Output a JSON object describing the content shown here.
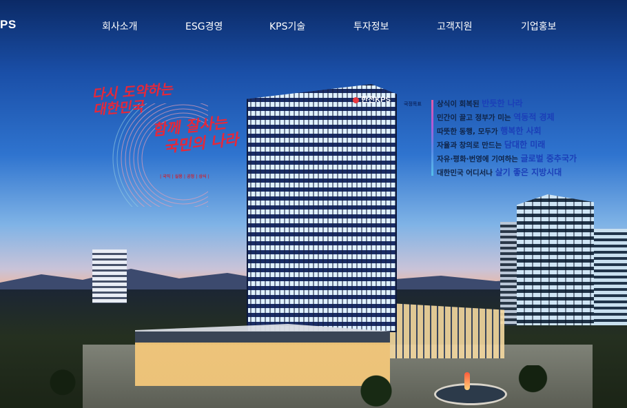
{
  "header": {
    "logo": "PS",
    "nav": [
      {
        "label": "회사소개"
      },
      {
        "label": "ESG경영"
      },
      {
        "label": "KPS기술"
      },
      {
        "label": "투자정보"
      },
      {
        "label": "고객지원"
      },
      {
        "label": "기업홍보"
      }
    ]
  },
  "hero": {
    "tower_sign": "한전KPS",
    "slogan": {
      "line1a": "다시 도약하는",
      "line1b": "대한민국",
      "line2a": "함께 잘사는",
      "line2b": "국민의 나라",
      "tags": "| 국익 | 실용 | 공정 | 상식 |"
    },
    "goals": {
      "label": "국정목표",
      "items": [
        {
          "pre": "상식이 회복된 ",
          "hl": "반듯한 나라"
        },
        {
          "pre": "민간이 끌고 정부가 미는 ",
          "hl": "역동적 경제"
        },
        {
          "pre": "따뜻한 동행, 모두가 ",
          "hl": "행복한 사회"
        },
        {
          "pre": "자율과 창의로 만드는 ",
          "hl": "담대한 미래"
        },
        {
          "pre": "자유·평화·번영에 기여하는 ",
          "hl": "글로벌 중추국가"
        },
        {
          "pre": "대한민국 어디서나 ",
          "hl": "살기 좋은 지방시대"
        }
      ]
    },
    "colors": {
      "accent_red": "#e5283a",
      "goal_highlight": "#1b3fb8",
      "nav_text": "#ffffff"
    }
  }
}
